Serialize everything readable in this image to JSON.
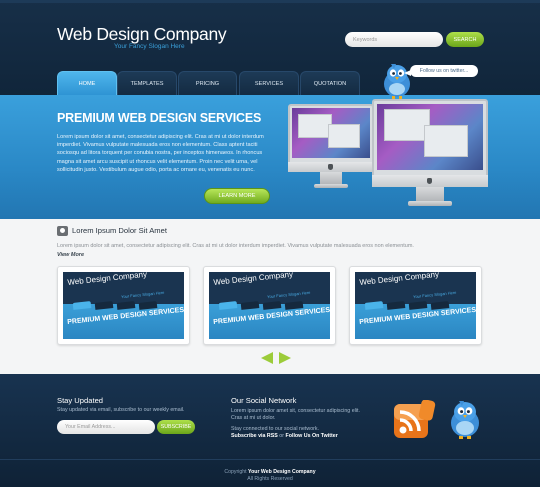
{
  "header": {
    "logo": "Web Design Company",
    "slogan": "Your Fancy Slogan Here",
    "search_placeholder": "Keywords",
    "search_button": "SEARCH"
  },
  "nav": {
    "tabs": [
      {
        "label": "HOME",
        "active": true
      },
      {
        "label": "TEMPLATES",
        "active": false
      },
      {
        "label": "PRICING",
        "active": false
      },
      {
        "label": "SERVICES",
        "active": false
      },
      {
        "label": "QUOTATION",
        "active": false
      }
    ]
  },
  "twitter_bubble": "Follow us on twitter...",
  "hero": {
    "title": "PREMIUM WEB DESIGN SERVICES",
    "text": "Lorem ipsum dolor sit amet, consectetur adipiscing elit. Cras at mi ut dolor interdum imperdiet. Vivamus vulputate malesuada eros non elementum. Class aptent taciti sociosqu ad litora torquent per conubia nostra, per inceptos himenaeos. In rhoncus magna sit amet arcu suscipit ut rhoncus velit elementum. Proin nec velit urna, vel sollicitudin justo. Vestibulum augue odio, porta ac ornare eu, venenatis eu nunc.",
    "button": "LEARN MORE"
  },
  "portfolio": {
    "title": "Lorem Ipsum Dolor Sit Amet",
    "text": "Lorem ipsum dolor sit amet, consectetur adipiscing elit. Cras at mi ut dolor interdum imperdiet. Vivamus vulputate malesuada eros non elementum.",
    "view_more": "View More",
    "thumbs": [
      {
        "logo": "Web Design Company",
        "slogan": "Your Fancy Slogan Here",
        "title": "PREMIUM WEB DESIGN SERVICES"
      },
      {
        "logo": "Web Design Company",
        "slogan": "Your Fancy Slogan Here",
        "title": "PREMIUM WEB DESIGN SERVICES"
      },
      {
        "logo": "Web Design Company",
        "slogan": "Your Fancy Slogan Here",
        "title": "PREMIUM WEB DESIGN SERVICES"
      }
    ]
  },
  "footer": {
    "stay_title": "Stay Updated",
    "stay_text": "Stay updated via email, subscribe to our weekly email.",
    "email_placeholder": "Your Email Address...",
    "subscribe_button": "SUBSCRIBE",
    "social_title": "Our Social Network",
    "social_text": "Lorem ipsum dolor amet sit, consectetur adipiscing elit. Cras at mi ut dolor.",
    "social_text2": "Stay connected to our social network.",
    "social_link_rss": "Subscribe via RSS",
    "social_or": "or",
    "social_link_twitter": "Follow Us On Twitter",
    "copyright_prefix": "Copyright",
    "copyright_company": "Your Web Design Company",
    "rights": "All Rights Reserved"
  },
  "icons": {
    "rss": "rss-icon",
    "twitter_bird": "twitter-bird-icon",
    "camera": "camera-icon",
    "arrow_left": "arrow-left-icon",
    "arrow_right": "arrow-right-icon",
    "monitor": "monitor-icon"
  },
  "colors": {
    "brand_blue": "#3aa0dc",
    "dark_navy": "#10253a",
    "accent_green": "#7ab62a",
    "content_bg": "#f4f5f6"
  }
}
